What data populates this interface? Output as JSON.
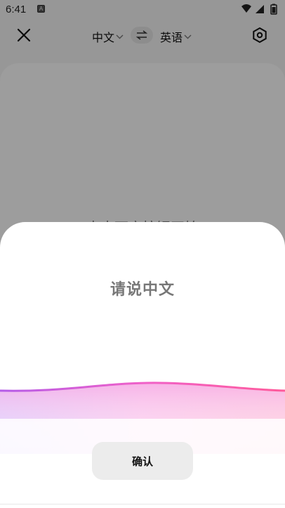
{
  "status": {
    "time": "6:41",
    "notif_letter": "A"
  },
  "topbar": {
    "source_lang": "中文",
    "target_lang": "英语"
  },
  "card": {
    "hint": "点击下方按钮开始"
  },
  "sheet": {
    "prompt": "请说中文",
    "confirm_label": "确认"
  },
  "colors": {
    "wave_start": "#b45ce8",
    "wave_mid": "#f060c8",
    "wave_end": "#ff5a9a"
  }
}
